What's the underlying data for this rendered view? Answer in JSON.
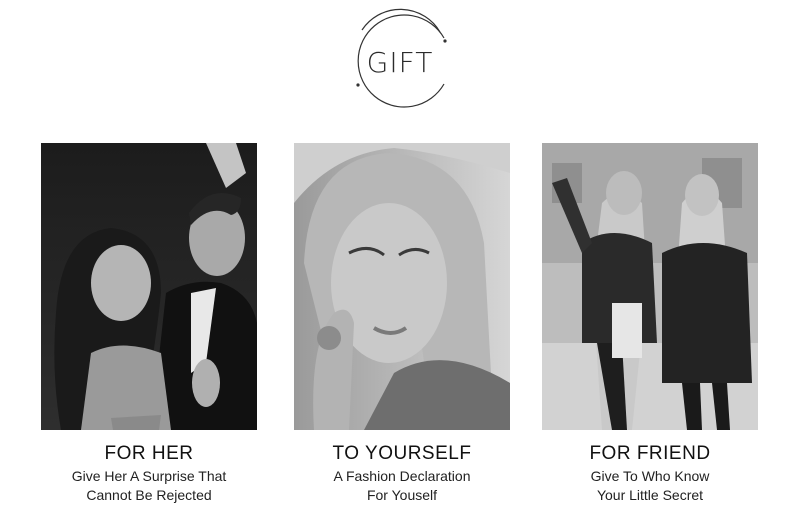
{
  "title": "GIFT",
  "cards": [
    {
      "heading": "FOR HER",
      "line1": "Give Her A Surprise That",
      "line2": "Cannot Be Rejected",
      "image": "couple-looking-up-photo"
    },
    {
      "heading": "TO YOURSELF",
      "line1": "A Fashion Declaration",
      "line2": "For Youself",
      "image": "woman-with-ring-photo"
    },
    {
      "heading": "FOR FRIEND",
      "line1": "Give To Who Know",
      "line2": "Your Little Secret",
      "image": "two-friends-walking-photo"
    }
  ]
}
